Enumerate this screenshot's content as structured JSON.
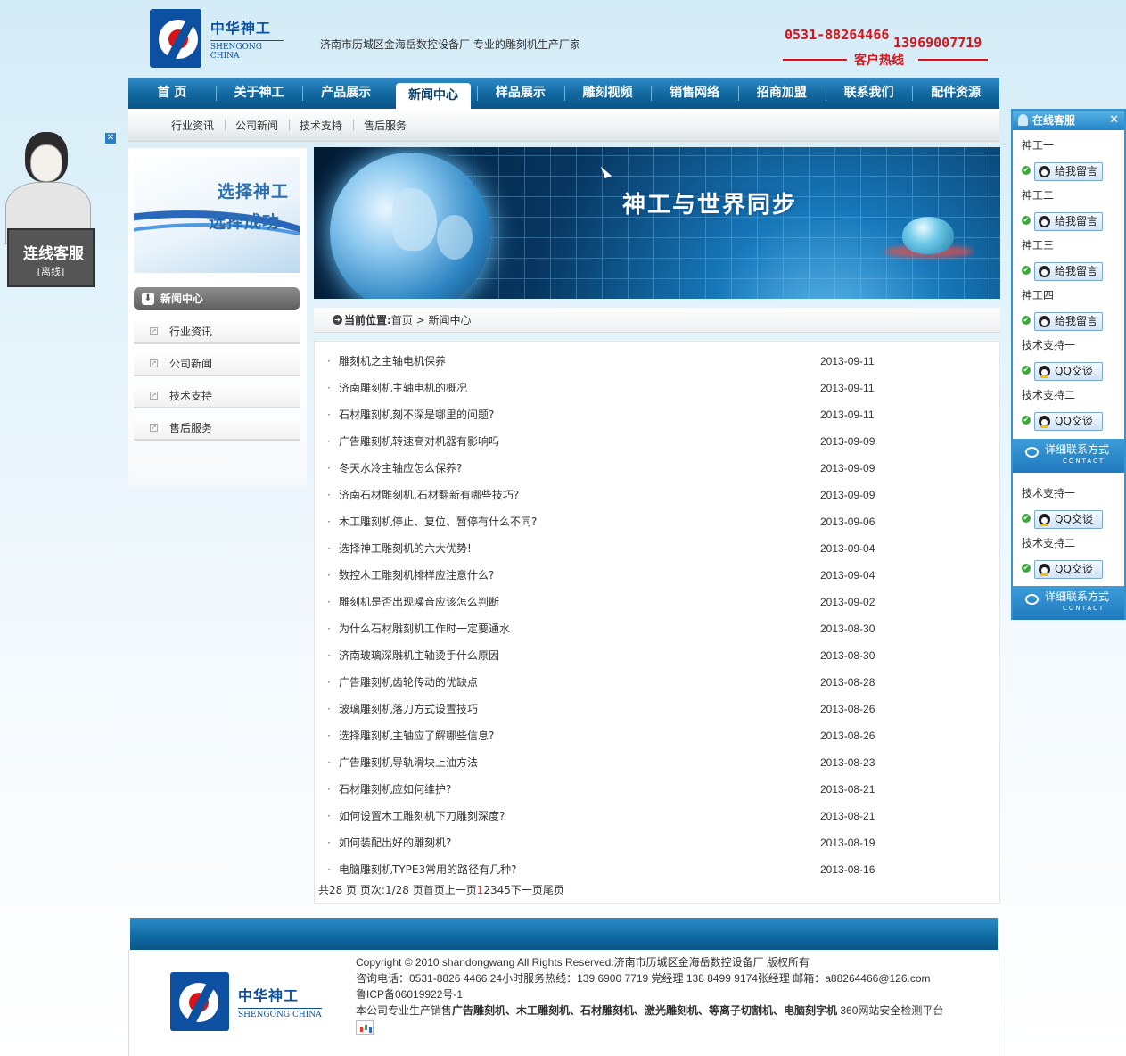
{
  "header": {
    "logo_cn": "中华神工",
    "logo_en": "SHENGONG CHINA",
    "slogan": "济南市历城区金海岳数控设备厂 专业的雕刻机生产厂家",
    "phone1": "0531-88264466",
    "phone2": "13969007719",
    "hotline_label": "客户热线"
  },
  "nav": {
    "items": [
      "首 页",
      "关于神工",
      "产品展示",
      "新闻中心",
      "样品展示",
      "雕刻视频",
      "销售网络",
      "招商加盟",
      "联系我们",
      "配件资源"
    ],
    "active_index": 3
  },
  "subnav": {
    "items": [
      "行业资讯",
      "公司新闻",
      "技术支持",
      "售后服务"
    ]
  },
  "sidebar": {
    "banner_line1": "选择神工",
    "banner_line2": "选择成功",
    "heading": "新闻中心",
    "items": [
      "行业资讯",
      "公司新闻",
      "技术支持",
      "售后服务"
    ]
  },
  "banner": {
    "title": "神工与世界同步"
  },
  "breadcrumb": {
    "label": "当前位置:",
    "path": "首页 > 新闻中心"
  },
  "news": [
    {
      "title": "雕刻机之主轴电机保养",
      "date": "2013-09-11"
    },
    {
      "title": "济南雕刻机主轴电机的概况",
      "date": "2013-09-11"
    },
    {
      "title": "石材雕刻机刻不深是哪里的问题?",
      "date": "2013-09-11"
    },
    {
      "title": "广告雕刻机转速高对机器有影响吗",
      "date": "2013-09-09"
    },
    {
      "title": "冬天水冷主轴应怎么保养?",
      "date": "2013-09-09"
    },
    {
      "title": "济南石材雕刻机,石材翻新有哪些技巧?",
      "date": "2013-09-09"
    },
    {
      "title": "木工雕刻机停止、复位、暂停有什么不同?",
      "date": "2013-09-06"
    },
    {
      "title": "选择神工雕刻机的六大优势!",
      "date": "2013-09-04"
    },
    {
      "title": "数控木工雕刻机排样应注意什么?",
      "date": "2013-09-04"
    },
    {
      "title": "雕刻机是否出现噪音应该怎么判断",
      "date": "2013-09-02"
    },
    {
      "title": "为什么石材雕刻机工作时一定要通水",
      "date": "2013-08-30"
    },
    {
      "title": "济南玻璃深雕机主轴烫手什么原因",
      "date": "2013-08-30"
    },
    {
      "title": "广告雕刻机齿轮传动的优缺点",
      "date": "2013-08-28"
    },
    {
      "title": "玻璃雕刻机落刀方式设置技巧",
      "date": "2013-08-26"
    },
    {
      "title": "选择雕刻机主轴应了解哪些信息?",
      "date": "2013-08-26"
    },
    {
      "title": "广告雕刻机导轨滑块上油方法",
      "date": "2013-08-23"
    },
    {
      "title": "石材雕刻机应如何维护?",
      "date": "2013-08-21"
    },
    {
      "title": "如何设置木工雕刻机下刀雕刻深度?",
      "date": "2013-08-21"
    },
    {
      "title": "如何装配出好的雕刻机?",
      "date": "2013-08-19"
    },
    {
      "title": "电脑雕刻机TYPE3常用的路径有几种?",
      "date": "2013-08-16"
    }
  ],
  "news_bullet": "·",
  "pager": {
    "prefix": "共28 页 页次:1/28 页首页上一页",
    "current": "1",
    "pages": "2345",
    "suffix": "下一页尾页"
  },
  "footer": {
    "line1": "Copyright © 2010 shandongwang All Rights Reserved.济南市历城区金海岳数控设备厂 版权所有",
    "line2": "咨询电话：0531-8826 4466 24小时服务热线：139 6900 7719 党经理 138 8499 9174张经理 邮箱：a88264466@126.com",
    "line3": "鲁ICP备06019922号-1",
    "line4_prefix": "本公司专业生产销售",
    "line4_bold": "广告雕刻机、木工雕刻机、石材雕刻机、激光雕刻机、等离子切割机、电脑刻字机",
    "line4_suffix": " 360网站安全检测平台",
    "cnzz_label": "CNZZ"
  },
  "left_service": {
    "title": "连线客服",
    "status": "[离线]",
    "close": "✕"
  },
  "right_service": {
    "title": "在线客服",
    "close": "✕",
    "entries": [
      {
        "name": "神工一",
        "button": "给我留言",
        "type": "msg"
      },
      {
        "name": "神工二",
        "button": "给我留言",
        "type": "msg"
      },
      {
        "name": "神工三",
        "button": "给我留言",
        "type": "msg"
      },
      {
        "name": "神工四",
        "button": "给我留言",
        "type": "msg"
      },
      {
        "name": "技术支持一",
        "button": "QQ交谈",
        "type": "qq"
      },
      {
        "name": "技术支持二",
        "button": "QQ交谈",
        "type": "qq"
      }
    ],
    "entries_lower": [
      {
        "name": "技术支持一",
        "button": "QQ交谈",
        "type": "qq"
      },
      {
        "name": "技术支持二",
        "button": "QQ交谈",
        "type": "qq"
      }
    ],
    "detail_label": "详细联系方式",
    "detail_en": "CONTACT"
  },
  "colors": {
    "nav_blue": "#11679f",
    "accent_red": "#d8141b",
    "logo_blue": "#0d4fa1"
  }
}
